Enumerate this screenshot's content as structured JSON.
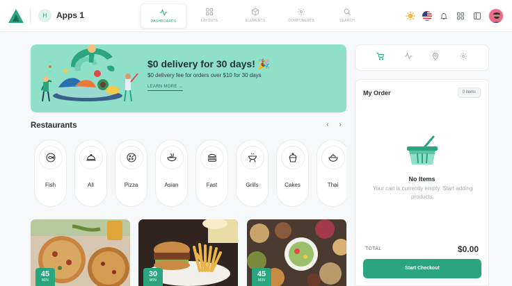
{
  "app": {
    "avatar_letter": "H",
    "title": "Apps 1"
  },
  "nav": [
    {
      "label": "DASHBOARDS",
      "icon": "activity-icon",
      "active": true
    },
    {
      "label": "LAYOUTS",
      "icon": "grid-icon",
      "active": false
    },
    {
      "label": "ELEMENTS",
      "icon": "cube-icon",
      "active": false
    },
    {
      "label": "COMPONENTS",
      "icon": "gear-icon",
      "active": false
    },
    {
      "label": "SEARCH",
      "icon": "search-icon",
      "active": false
    }
  ],
  "toolbar_icons": [
    "sun-icon",
    "us-flag-icon",
    "bell-icon",
    "apps-grid-icon",
    "sidebar-toggle-icon"
  ],
  "promo": {
    "title": "$0 delivery for 30 days! 🎉",
    "subtitle": "$0 delivery fee for orders over $10 for 30 days",
    "link": "LEARN MORE"
  },
  "restaurants": {
    "title": "Restaurants",
    "categories": [
      {
        "label": "Fish",
        "icon": "fish-plate-icon"
      },
      {
        "label": "All",
        "icon": "cloche-icon"
      },
      {
        "label": "Pizza",
        "icon": "pizza-icon"
      },
      {
        "label": "Asian",
        "icon": "noodle-bowl-icon"
      },
      {
        "label": "Fast",
        "icon": "burger-icon"
      },
      {
        "label": "Grills",
        "icon": "grill-icon"
      },
      {
        "label": "Cakes",
        "icon": "cupcake-icon"
      },
      {
        "label": "Thai",
        "icon": "salad-bowl-icon"
      }
    ]
  },
  "food_cards": [
    {
      "time": "45",
      "unit": "MIN",
      "image": "pizza-photo"
    },
    {
      "time": "30",
      "unit": "MIN",
      "image": "burger-fries-photo"
    },
    {
      "time": "45",
      "unit": "MIN",
      "image": "mezze-spread-photo"
    }
  ],
  "order": {
    "tabs": [
      "cart-icon",
      "activity-icon",
      "location-pin-icon",
      "gear-icon"
    ],
    "title": "My Order",
    "items_badge": "0 items",
    "empty_title": "No Items",
    "empty_text": "Your cart is currently empty. Start adding products.",
    "total_label": "TOTAL",
    "total_value": "$0.00",
    "checkout_label": "Start Checkout"
  },
  "colors": {
    "accent": "#2ba57f",
    "banner": "#8ee0c9"
  }
}
